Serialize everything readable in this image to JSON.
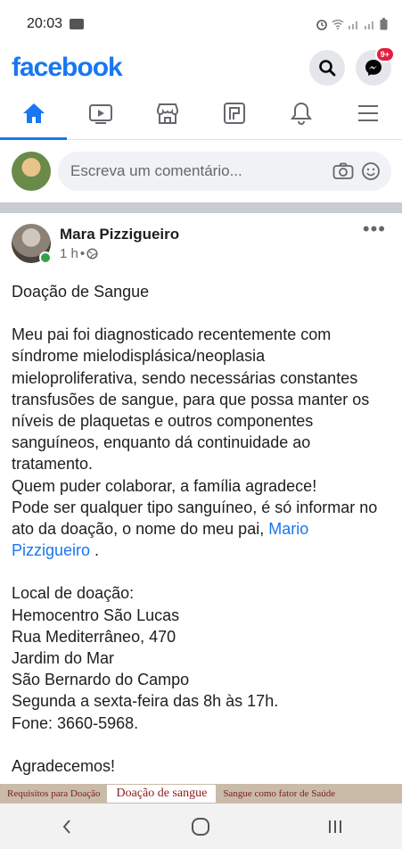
{
  "status_bar": {
    "time": "20:03"
  },
  "header": {
    "logo": "facebook",
    "messenger_badge": "9+"
  },
  "tabs": [
    {
      "name": "home-icon",
      "active": true
    },
    {
      "name": "watch-icon",
      "active": false
    },
    {
      "name": "marketplace-icon",
      "active": false
    },
    {
      "name": "pages-icon",
      "active": false
    },
    {
      "name": "notifications-icon",
      "active": false
    },
    {
      "name": "menu-icon",
      "active": false
    }
  ],
  "composer": {
    "placeholder": "Escreva um comentário..."
  },
  "post": {
    "author": "Mara Pizzigueiro",
    "time": "1 h",
    "separator": "•",
    "title": "Doação de Sangue",
    "para1": "Meu pai foi diagnosticado recentemente com síndrome mielodisplásica/neoplasia mieloproliferativa, sendo necessárias constantes transfusões de sangue, para que possa manter os níveis de plaquetas e outros componentes sanguíneos, enquanto dá continuidade ao tratamento.",
    "para2": "Quem puder colaborar, a família agradece!",
    "para3_start": "Pode ser qualquer tipo sanguíneo, é só informar no ato da doação, o nome do meu pai,",
    "mention": "Mario Pizzigueiro",
    "para3_end": " .",
    "location_lines": [
      "Local de doação:",
      "Hemocentro São Lucas",
      "Rua Mediterrâneo, 470",
      "Jardim do Mar",
      "São Bernardo do Campo",
      "Segunda a sexta-feira das 8h às 17h.",
      "Fone: 3660-5968."
    ],
    "closing": "Agradecemos!"
  },
  "banner": {
    "left": "Requisitos para Doação",
    "middle": "Doação de sangue",
    "right": "Sangue como fator de Saúde"
  },
  "colors": {
    "brand": "#1877f2",
    "online": "#31a24c",
    "badge": "#e41e3f"
  }
}
